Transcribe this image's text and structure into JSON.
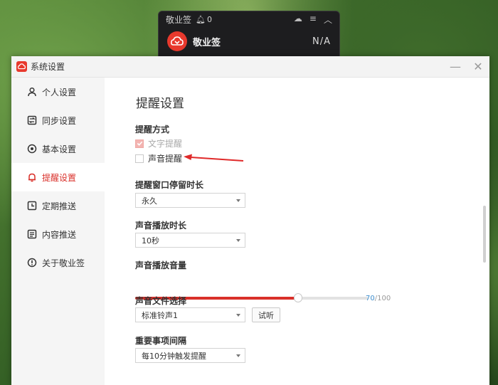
{
  "widget": {
    "title": "敬业签",
    "count": "0",
    "app_name": "敬业签",
    "value": "N/A"
  },
  "dialog": {
    "title": "系统设置",
    "minimize": "—",
    "close": "✕"
  },
  "sidebar": {
    "items": [
      {
        "label": "个人设置",
        "icon": "person-icon"
      },
      {
        "label": "同步设置",
        "icon": "sync-icon"
      },
      {
        "label": "基本设置",
        "icon": "settings-icon"
      },
      {
        "label": "提醒设置",
        "icon": "bell-icon",
        "active": true
      },
      {
        "label": "定期推送",
        "icon": "clock-icon"
      },
      {
        "label": "内容推送",
        "icon": "document-icon"
      },
      {
        "label": "关于敬业签",
        "icon": "info-icon"
      }
    ]
  },
  "content": {
    "title": "提醒设置",
    "remind_method": {
      "label": "提醒方式",
      "text_remind": {
        "label": "文字提醒",
        "checked": true,
        "disabled": true
      },
      "sound_remind": {
        "label": "声音提醒",
        "checked": false
      }
    },
    "window_duration": {
      "label": "提醒窗口停留时长",
      "value": "永久"
    },
    "sound_duration": {
      "label": "声音播放时长",
      "value": "10秒"
    },
    "volume": {
      "label": "声音播放音量",
      "value": 70,
      "max": 100,
      "value_text": "70",
      "max_text": "/100"
    },
    "sound_file": {
      "label": "声音文件选择",
      "value": "标准铃声1",
      "test_label": "试听"
    },
    "important_interval": {
      "label": "重要事项间隔",
      "value": "每10分钟触发提醒"
    }
  },
  "colors": {
    "accent": "#d9302a",
    "brand": "#e8392d",
    "volume_value": "#3d8ccc"
  }
}
